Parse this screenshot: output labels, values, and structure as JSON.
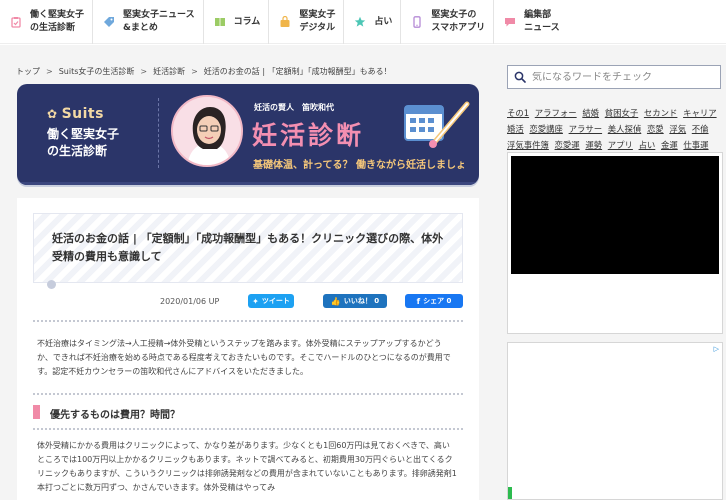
{
  "nav": [
    {
      "label": "働く堅実女子\nの生活診断",
      "icon": "clipboard-icon",
      "color": "#f08aa7"
    },
    {
      "label": "堅実女子ニュース\n&まとめ",
      "icon": "tag-icon",
      "color": "#6fa8dc"
    },
    {
      "label": "コラム",
      "icon": "book-icon",
      "color": "#9ccc65"
    },
    {
      "label": "堅実女子\nデジタル",
      "icon": "bag-icon",
      "color": "#f0b54a"
    },
    {
      "label": "占い",
      "icon": "star-icon",
      "color": "#4cc6b5"
    },
    {
      "label": "堅実女子の\nスマホアプリ",
      "icon": "smartphone-icon",
      "color": "#b58ad6"
    },
    {
      "label": "編集部\nニュース",
      "icon": "chat-icon",
      "color": "#f08aa7"
    }
  ],
  "breadcrumb": [
    "トップ",
    "Suits女子の生活診断",
    "妊活診断",
    "妊活のお金の話 | 「定額制」「成功報酬型」もある！ク..."
  ],
  "hero": {
    "brand": "Suits",
    "subtitle": "働く堅実女子\nの生活診断",
    "author": "妊活の賢人　笛吹和代",
    "title": "妊活診断",
    "tagline": "基礎体温、計ってる？ 働きながら妊活しましょ"
  },
  "article": {
    "title": "妊活のお金の話 | 「定額制」「成功報酬型」もある！クリニック選びの際、体外受精の費用も意識して",
    "date": "2020/01/06 UP",
    "share_twitter": "ツイート",
    "share_hatena": "いいね！ 0",
    "share_facebook": "シェア 0",
    "intro": "不妊治療はタイミング法→人工授精→体外受精というステップを踏みます。体外受精にステップアップするかどうか、できれば不妊治療を始める時点である程度考えておきたいものです。そこでハードルのひとつになるのが費用です。認定不妊カウンセラーの笛吹和代さんにアドバイスをいただきました。",
    "heading": "優先するものは費用？時間？",
    "body": "体外受精にかかる費用はクリニックによって、かなり差があります。少なくとも1回60万円は見ておくべきで、高いところでは100万円以上かかるクリニックもあります。ネットで調べてみると、初期費用30万円ぐらいと出てくるクリニックもありますが、こういうクリニックは排卵誘発剤などの費用が含まれていないこともあります。排卵誘発剤1本打つごとに数万円ずつ、かさんでいきます。体外受精はやってみ"
  },
  "sidebar": {
    "search_placeholder": "気になるワードをチェック",
    "tags": [
      "その1",
      "アラフォー",
      "結婚",
      "貧困女子",
      "セカンド",
      "キャリア",
      "婚活",
      "恋愛講座",
      "アラサー",
      "美人探偵",
      "恋愛",
      "浮気",
      "不倫",
      "浮気事件簿",
      "恋愛運",
      "運勢",
      "アプリ",
      "占い",
      "金運",
      "仕事運"
    ],
    "ad_choice": "▷"
  },
  "colors": {
    "hero_bg": "#2b3569",
    "hero_title": "#f38fb1",
    "accent_pink": "#f08aa7",
    "twitter": "#1da1f2",
    "facebook": "#1877f2"
  }
}
